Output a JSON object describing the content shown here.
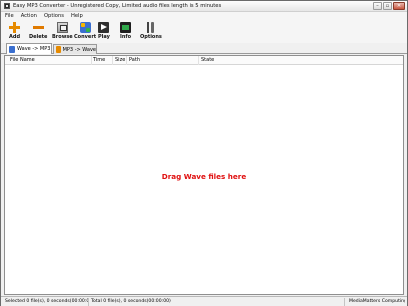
{
  "window": {
    "title": "Easy MP3 Converter - Unregistered Copy, Limited audio files length is 5 minutes",
    "controls": [
      "minimize-icon",
      "restore-icon",
      "close-icon"
    ]
  },
  "menu": [
    "File",
    "Action",
    "Options",
    "Help"
  ],
  "toolbar": {
    "add": "Add",
    "delete": "Delete",
    "browse": "Browse",
    "convert": "Convert",
    "play": "Play",
    "info": "Info",
    "options": "Options"
  },
  "tabs": [
    {
      "label": "Wave -> MP3",
      "icon": "wave-to-mp3-icon",
      "active": true
    },
    {
      "label": "MP3 -> Wave",
      "icon": "mp3-to-wave-icon",
      "active": false
    }
  ],
  "columns": [
    "File Name",
    "Time",
    "Size",
    "Path",
    "State"
  ],
  "empty_message": "Drag Wave files here",
  "status": {
    "selected": "Selected 0 file(s), 0 seconds(00:00:00)",
    "total": "Total 0 file(s), 0 seconds(00:00:00)",
    "vendor": "MediaMatters Computing"
  },
  "colors": {
    "empty_message": "#e01010",
    "add_icon": "#e68a00"
  }
}
